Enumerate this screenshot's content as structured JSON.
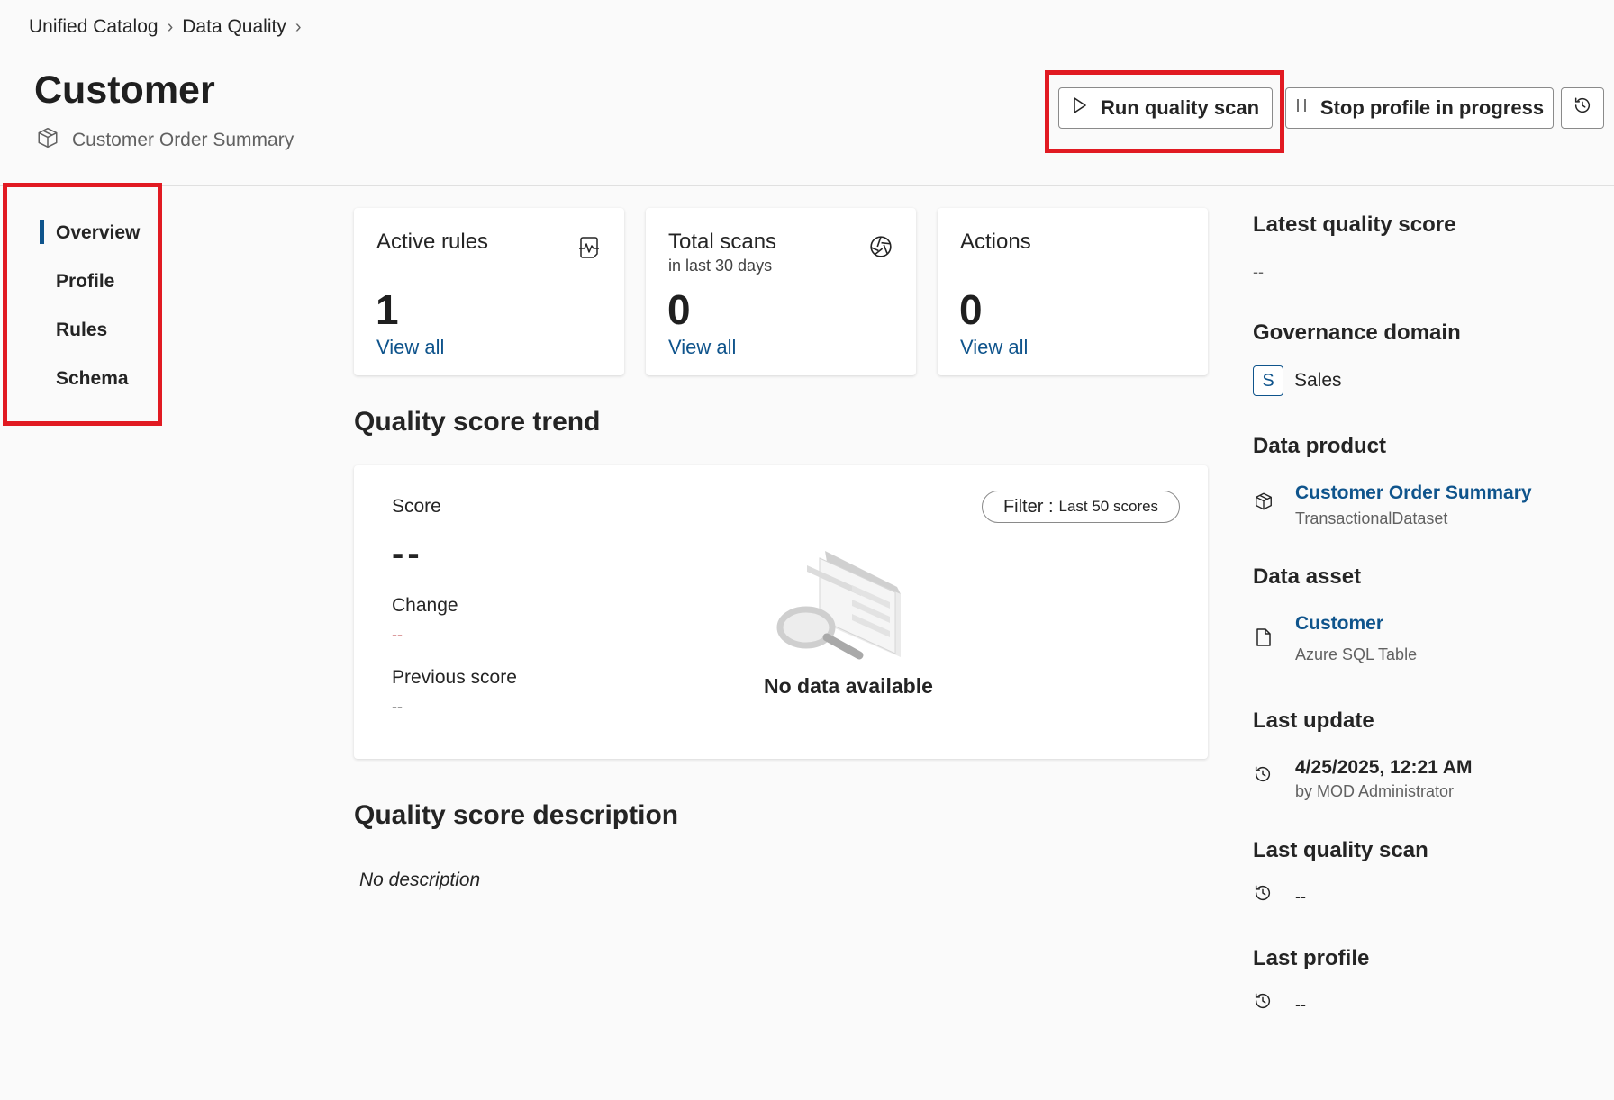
{
  "breadcrumb": {
    "items": [
      "Unified Catalog",
      "Data Quality"
    ]
  },
  "header": {
    "title": "Customer",
    "subtitle": "Customer Order Summary",
    "run_scan_label": "Run quality scan",
    "stop_profile_label": "Stop profile in progress"
  },
  "nav": {
    "items": [
      "Overview",
      "Profile",
      "Rules",
      "Schema"
    ],
    "active": "Overview"
  },
  "metrics": [
    {
      "title": "Active rules",
      "sub": "",
      "value": "1",
      "link": "View all",
      "icon": "rule-pulse-icon"
    },
    {
      "title": "Total scans",
      "sub": "in last 30 days",
      "value": "0",
      "link": "View all",
      "icon": "aperture-icon"
    },
    {
      "title": "Actions",
      "sub": "",
      "value": "0",
      "link": "View all",
      "icon": ""
    }
  ],
  "trend": {
    "title": "Quality score trend",
    "score_label": "Score",
    "score_value": "--",
    "change_label": "Change",
    "change_value": "--",
    "previous_label": "Previous score",
    "previous_value": "--",
    "filter_key": "Filter :",
    "filter_value": "Last 50 scores",
    "empty_text": "No data available"
  },
  "description": {
    "title": "Quality score description",
    "text": "No description"
  },
  "details": {
    "latest_score_label": "Latest quality score",
    "latest_score_value": "--",
    "domain_label": "Governance domain",
    "domain_badge": "S",
    "domain_value": "Sales",
    "product_label": "Data product",
    "product_name": "Customer Order Summary",
    "product_type": "TransactionalDataset",
    "asset_label": "Data asset",
    "asset_name": "Customer",
    "asset_type": "Azure SQL Table",
    "last_update_label": "Last update",
    "last_update_value": "4/25/2025, 12:21 AM",
    "last_update_by": "by MOD Administrator",
    "last_scan_label": "Last quality scan",
    "last_scan_value": "--",
    "last_profile_label": "Last profile",
    "last_profile_value": "--"
  },
  "colors": {
    "accent": "#0f548c",
    "highlight": "#e11a22",
    "change": "#b3262b"
  }
}
